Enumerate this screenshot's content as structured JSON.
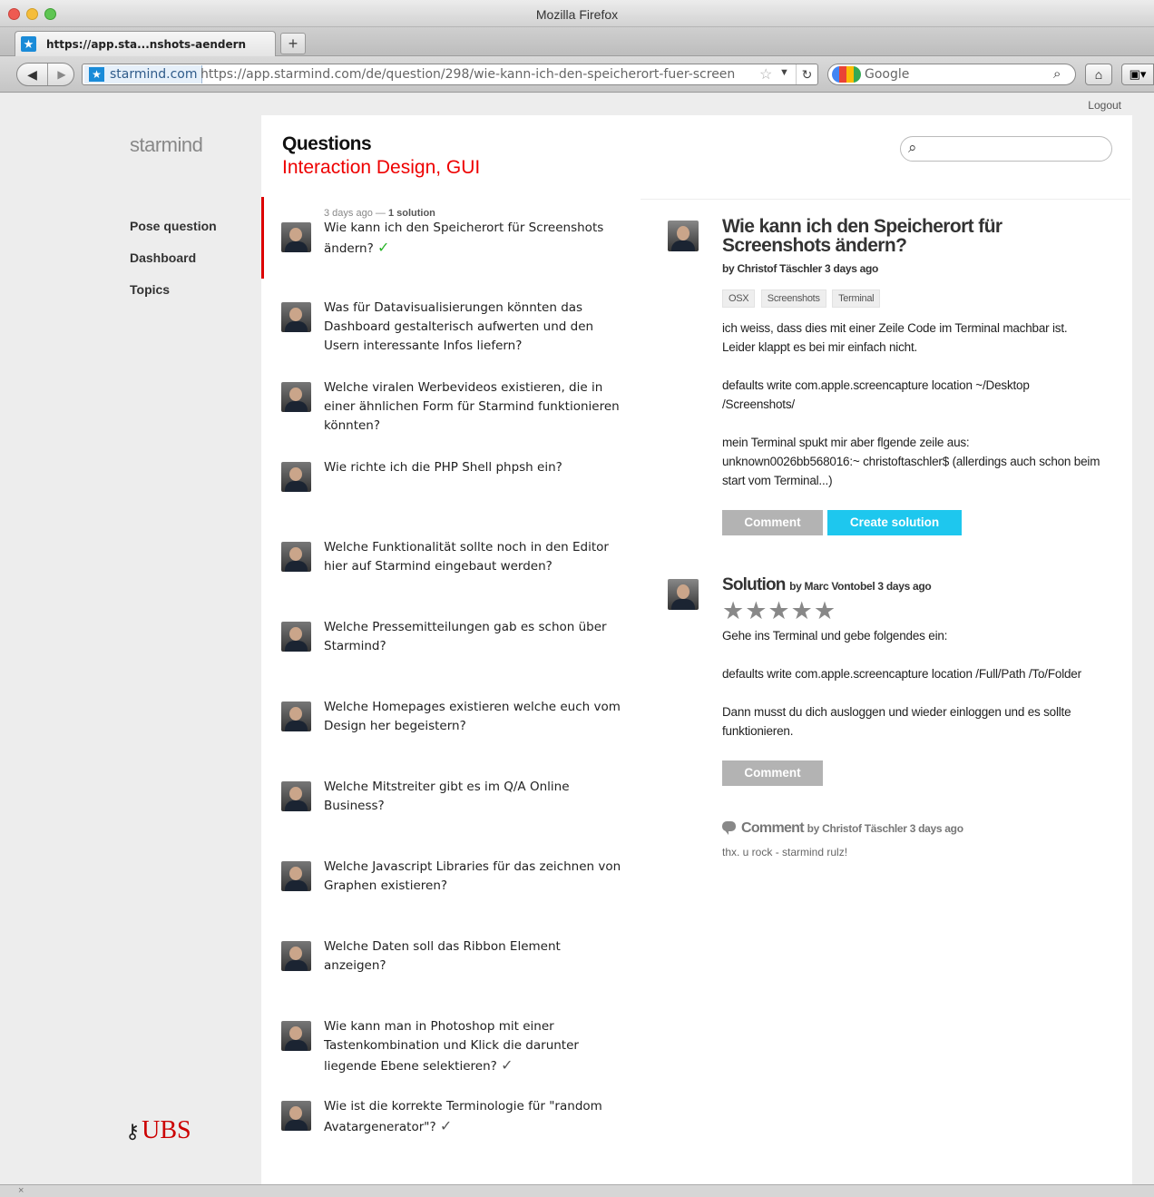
{
  "window": {
    "title": "Mozilla Firefox"
  },
  "tab": {
    "title": "https://app.sta...nshots-aendern",
    "new_tab_label": "+"
  },
  "navbar": {
    "site_identity": "starmind.com",
    "url": "https://app.starmind.com/de/question/298/wie-kann-ich-den-speicherort-fuer-screen",
    "search_engine": "Google"
  },
  "page": {
    "logout_label": "Logout",
    "logo": "starmind",
    "nav": [
      "Pose question",
      "Dashboard",
      "Topics"
    ],
    "sponsor": "UBS",
    "heading": "Questions",
    "subheading": "Interaction Design, GUI"
  },
  "questions": [
    {
      "meta_time": "3 days ago —",
      "meta_solutions": "1 solution",
      "text": "Wie kann ich den Speicherort für Screenshots ändern?",
      "solved": "green"
    },
    {
      "text": "Was für Datavisualisierungen könnten das Dashboard gestalterisch aufwerten und den Usern interessante Infos liefern?"
    },
    {
      "text": "Welche viralen Werbevideos existieren, die in einer ähnlichen Form für Starmind funktionieren könnten?"
    },
    {
      "text": "Wie richte ich die PHP Shell phpsh ein?"
    },
    {
      "text": "Welche Funktionalität sollte noch in den Editor hier auf Starmind eingebaut werden?"
    },
    {
      "text": "Welche Pressemitteilungen gab es schon über Starmind?"
    },
    {
      "text": "Welche Homepages existieren welche euch vom Design her begeistern?"
    },
    {
      "text": "Welche Mitstreiter gibt es im Q/A Online Business?"
    },
    {
      "text": "Welche Javascript Libraries für das zeichnen von Graphen existieren?"
    },
    {
      "text": "Welche Daten soll das Ribbon Element anzeigen?"
    },
    {
      "text": "Wie kann man in Photoshop mit einer Tastenkombination und Klick die darunter liegende Ebene selektieren?",
      "solved": "grey"
    },
    {
      "text": "Wie ist die korrekte Terminologie für \"random Avatargenerator\"?",
      "solved": "grey"
    }
  ],
  "detail": {
    "title": "Wie kann ich den Speicherort für Screenshots ändern?",
    "byline": "by Christof Täschler 3 days ago",
    "tags": [
      "OSX",
      "Screenshots",
      "Terminal"
    ],
    "paragraphs": [
      "ich weiss, dass dies mit einer Zeile Code im Terminal machbar ist. Leider klappt es bei mir einfach nicht.",
      "defaults write com.apple.screencapture location ~/Desktop /Screenshots/",
      "mein Terminal spukt mir aber flgende zeile aus: unknown0026bb568016:~ christoftaschler$ (allerdings auch schon beim start vom Terminal...)"
    ],
    "comment_button": "Comment",
    "create_solution_button": "Create solution"
  },
  "solution": {
    "label": "Solution",
    "byline": "by Marc Vontobel 3 days ago",
    "stars": "★★★★★",
    "rating": 5,
    "paragraphs": [
      "Gehe ins Terminal und gebe folgendes ein:",
      "defaults write com.apple.screencapture location /Full/Path /To/Folder",
      "Dann musst du dich ausloggen und wieder einloggen und es sollte funktionieren."
    ],
    "comment_button": "Comment"
  },
  "comment": {
    "label": "Comment",
    "byline": "by Christof Täschler 3 days ago",
    "text": "thx. u rock - starmind rulz!"
  },
  "statusbar": {
    "text": "×"
  },
  "colors": {
    "accent_red": "#dd0000",
    "button_blue": "#1ec7ee",
    "button_grey": "#b3b3b3",
    "check_green": "#2ab52a"
  }
}
